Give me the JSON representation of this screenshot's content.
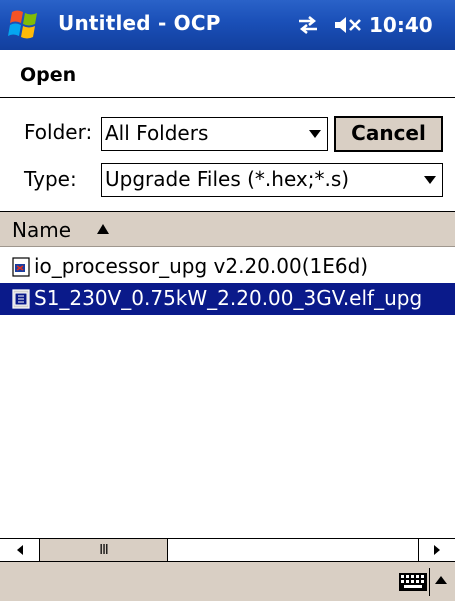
{
  "window": {
    "title": "Untitled - OCP",
    "clock": "10:40"
  },
  "dialog": {
    "title": "Open",
    "folder_label": "Folder:",
    "folder_value": "All Folders",
    "cancel_label": "Cancel",
    "type_label": "Type:",
    "type_value": "Upgrade Files (*.hex;*.s)"
  },
  "list": {
    "column_name": "Name",
    "sort": "ascending",
    "items": [
      {
        "name": "io_processor_upg v2.20.00(1E6d)",
        "icon": "hex-file-icon",
        "selected": false
      },
      {
        "name": "S1_230V_0.75kW_2.20.00_3GV.elf_upg",
        "icon": "s-file-icon",
        "selected": true
      }
    ]
  },
  "scrollbar": {
    "thumb_grip": "III",
    "position": 0.0
  },
  "colors": {
    "titlebar": "#1a4fb7",
    "selection": "#0a1a8a",
    "chrome": "#d9cfc4"
  }
}
